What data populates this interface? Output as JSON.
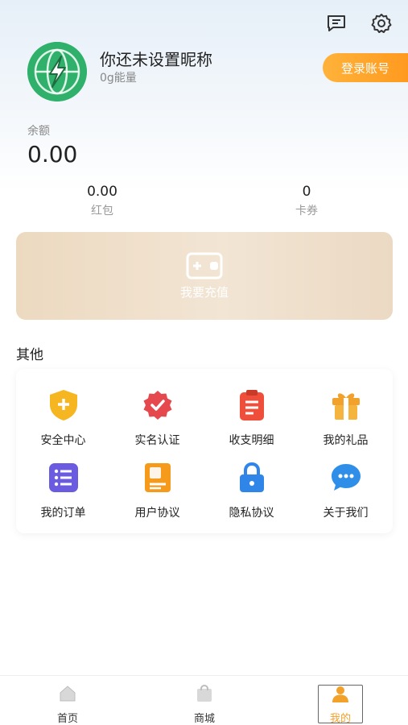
{
  "profile": {
    "nickname": "你还未设置昵称",
    "energy": "0g能量",
    "login_button": "登录账号"
  },
  "header_icons": [
    "message-icon",
    "settings-icon"
  ],
  "balance": {
    "label": "余额",
    "value": "0.00"
  },
  "stats": [
    {
      "value": "0.00",
      "label": "红包"
    },
    {
      "value": "0",
      "label": "卡券"
    }
  ],
  "recharge": {
    "label": "我要充值"
  },
  "other_section": {
    "title": "其他",
    "items": [
      {
        "label": "安全中心",
        "icon": "shield-icon",
        "color": "#f5b622"
      },
      {
        "label": "实名认证",
        "icon": "verified-badge-icon",
        "color": "#e5484d"
      },
      {
        "label": "收支明细",
        "icon": "clipboard-icon",
        "color": "#ef4f3a"
      },
      {
        "label": "我的礼品",
        "icon": "gift-icon",
        "color": "#f2a12a"
      },
      {
        "label": "我的订单",
        "icon": "list-icon",
        "color": "#6a5be0"
      },
      {
        "label": "用户协议",
        "icon": "document-icon",
        "color": "#f59a1b"
      },
      {
        "label": "隐私协议",
        "icon": "lock-icon",
        "color": "#2f86e8"
      },
      {
        "label": "关于我们",
        "icon": "chat-bubble-icon",
        "color": "#2f8fe8"
      }
    ]
  },
  "tabbar": [
    {
      "label": "首页",
      "icon": "home-icon"
    },
    {
      "label": "商城",
      "icon": "shop-bag-icon"
    },
    {
      "label": "我的",
      "icon": "user-icon",
      "active": true
    }
  ],
  "colors": {
    "accent_orange": "#ff9a1f",
    "avatar_green": "#2fb06b",
    "recharge_bg": "#efdfca"
  }
}
